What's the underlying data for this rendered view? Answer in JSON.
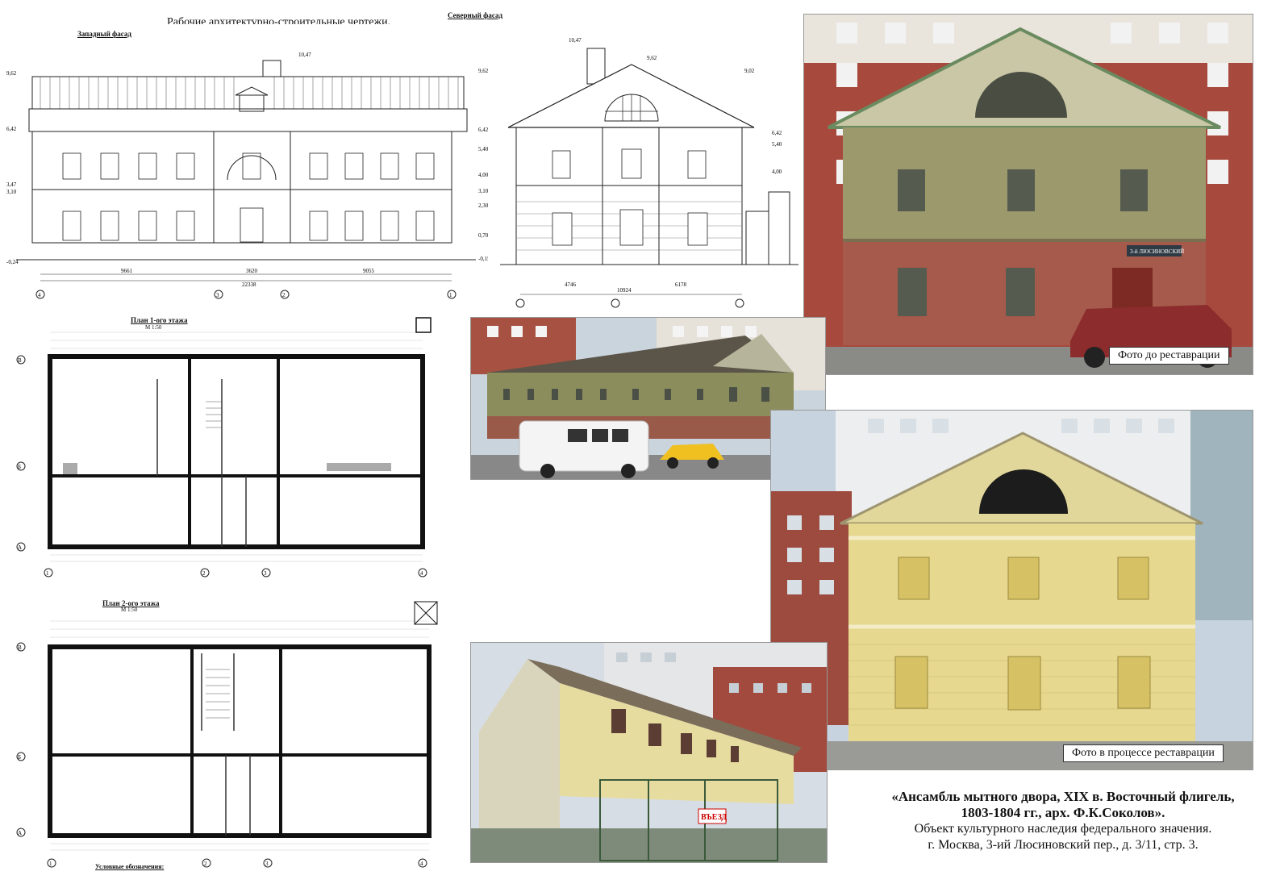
{
  "sheet": {
    "title": "Рабочие архитектурно-строительные чертежи."
  },
  "elevations": {
    "west": {
      "label": "Западный фасад",
      "marks_left": [
        "9,62",
        "6,42",
        "3,47",
        "3,10",
        "-0,24"
      ],
      "marks_right": [
        "9,62",
        "6,42",
        "5,40",
        "4,00",
        "3,10",
        "2,30",
        "0,70",
        "-0,15"
      ],
      "top_mark": "10,47",
      "dims": [
        "9661",
        "3620",
        "9055"
      ],
      "total": "22338",
      "axes": [
        "4",
        "3",
        "2",
        "1"
      ]
    },
    "north": {
      "label": "Северный фасад",
      "top_mark": "10,47",
      "ridge_mark": "9,62",
      "marks": [
        "9,02",
        "6,42",
        "5,40",
        "4,00"
      ],
      "dims": [
        "4746",
        "6178"
      ],
      "total": "10924"
    }
  },
  "plans": {
    "first": {
      "label": "План 1-ого этажа",
      "scale": "М 1:50",
      "rows": [
        "В",
        "Б",
        "А"
      ],
      "cols": [
        "1",
        "2",
        "3",
        "4"
      ]
    },
    "second": {
      "label": "План  2-ого этажа",
      "scale": "М 1:50",
      "rows": [
        "В",
        "Б",
        "А"
      ],
      "cols": [
        "1",
        "2",
        "3",
        "4"
      ],
      "legend": "Условные обозначения:"
    }
  },
  "photos": {
    "before": {
      "caption": "Фото до реставрации",
      "plaque": "3-й ЛЮСИНОВСКИЙ"
    },
    "during": {
      "caption": "Фото в процессе реставрации"
    },
    "gate_sign": "ВЪЕЗД"
  },
  "info": {
    "line1": "«Ансамбль мытного двора, XIX в. Восточный флигель,",
    "line2": "1803-1804 гг., арх. Ф.К.Соколов».",
    "line3": "Объект культурного наследия федерального значения.",
    "line4": "г. Москва, 3-ий Люсиновский пер., д. 3/11, стр. 3."
  }
}
